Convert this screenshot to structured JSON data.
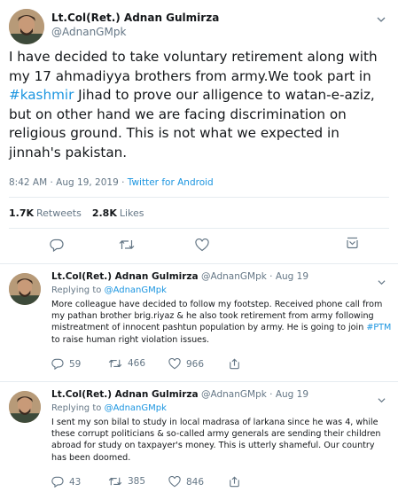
{
  "main_tweet": {
    "name": "Lt.Col(Ret.) Adnan Gulmirza",
    "handle": "@AdnanGMpk",
    "text_part1": "I have decided to take voluntary retirement along with my 17 ahmadiyya  brothers from army.We took part in ",
    "hashtag": "#kashmir",
    "text_part2": " Jihad to prove our alligence to watan-e-aziz, but on other hand we are facing discrimination on religious ground. This is not what we expected in jinnah's pakistan.",
    "timestamp": "8:42 AM · Aug 19, 2019 · ",
    "source": "Twitter for Android",
    "retweets_count": "1.7K",
    "retweets_label": "Retweets",
    "likes_count": "2.8K",
    "likes_label": "Likes"
  },
  "replies": [
    {
      "name": "Lt.Col(Ret.) Adnan Gulmirza",
      "handle_date": "@AdnanGMpk · Aug 19",
      "replying_label": "Replying to ",
      "replying_to": "@AdnanGMpk",
      "text_part1": "More colleague have decided to follow my footstep. Received phone call from my pathan brother brig.riyaz & he also took retirement from army following mistreatment of innocent pashtun population by army. He is going to join ",
      "hashtag": "#PTM",
      "text_part2": " to raise human right violation issues.",
      "reply_count": "59",
      "retweet_count": "466",
      "like_count": "966"
    },
    {
      "name": "Lt.Col(Ret.) Adnan Gulmirza",
      "handle_date": "@AdnanGMpk · Aug 19",
      "replying_label": "Replying to ",
      "replying_to": "@AdnanGMpk",
      "text": "I sent my son bilal to study in local madrasa of larkana since he was 4, while these corrupt politicians & so-called army generals are sending their children abroad for study on taxpayer's money. This is utterly shameful. Our country has been doomed.",
      "reply_count": "43",
      "retweet_count": "385",
      "like_count": "846"
    }
  ],
  "icons": {
    "reply": "reply-icon",
    "retweet": "retweet-icon",
    "like": "heart-icon",
    "share": "share-icon",
    "caret": "chevron-down-icon"
  },
  "colors": {
    "link": "#1b95e0",
    "secondary_text": "#657786",
    "primary_text": "#14171a",
    "divider": "#e6ecf0"
  }
}
